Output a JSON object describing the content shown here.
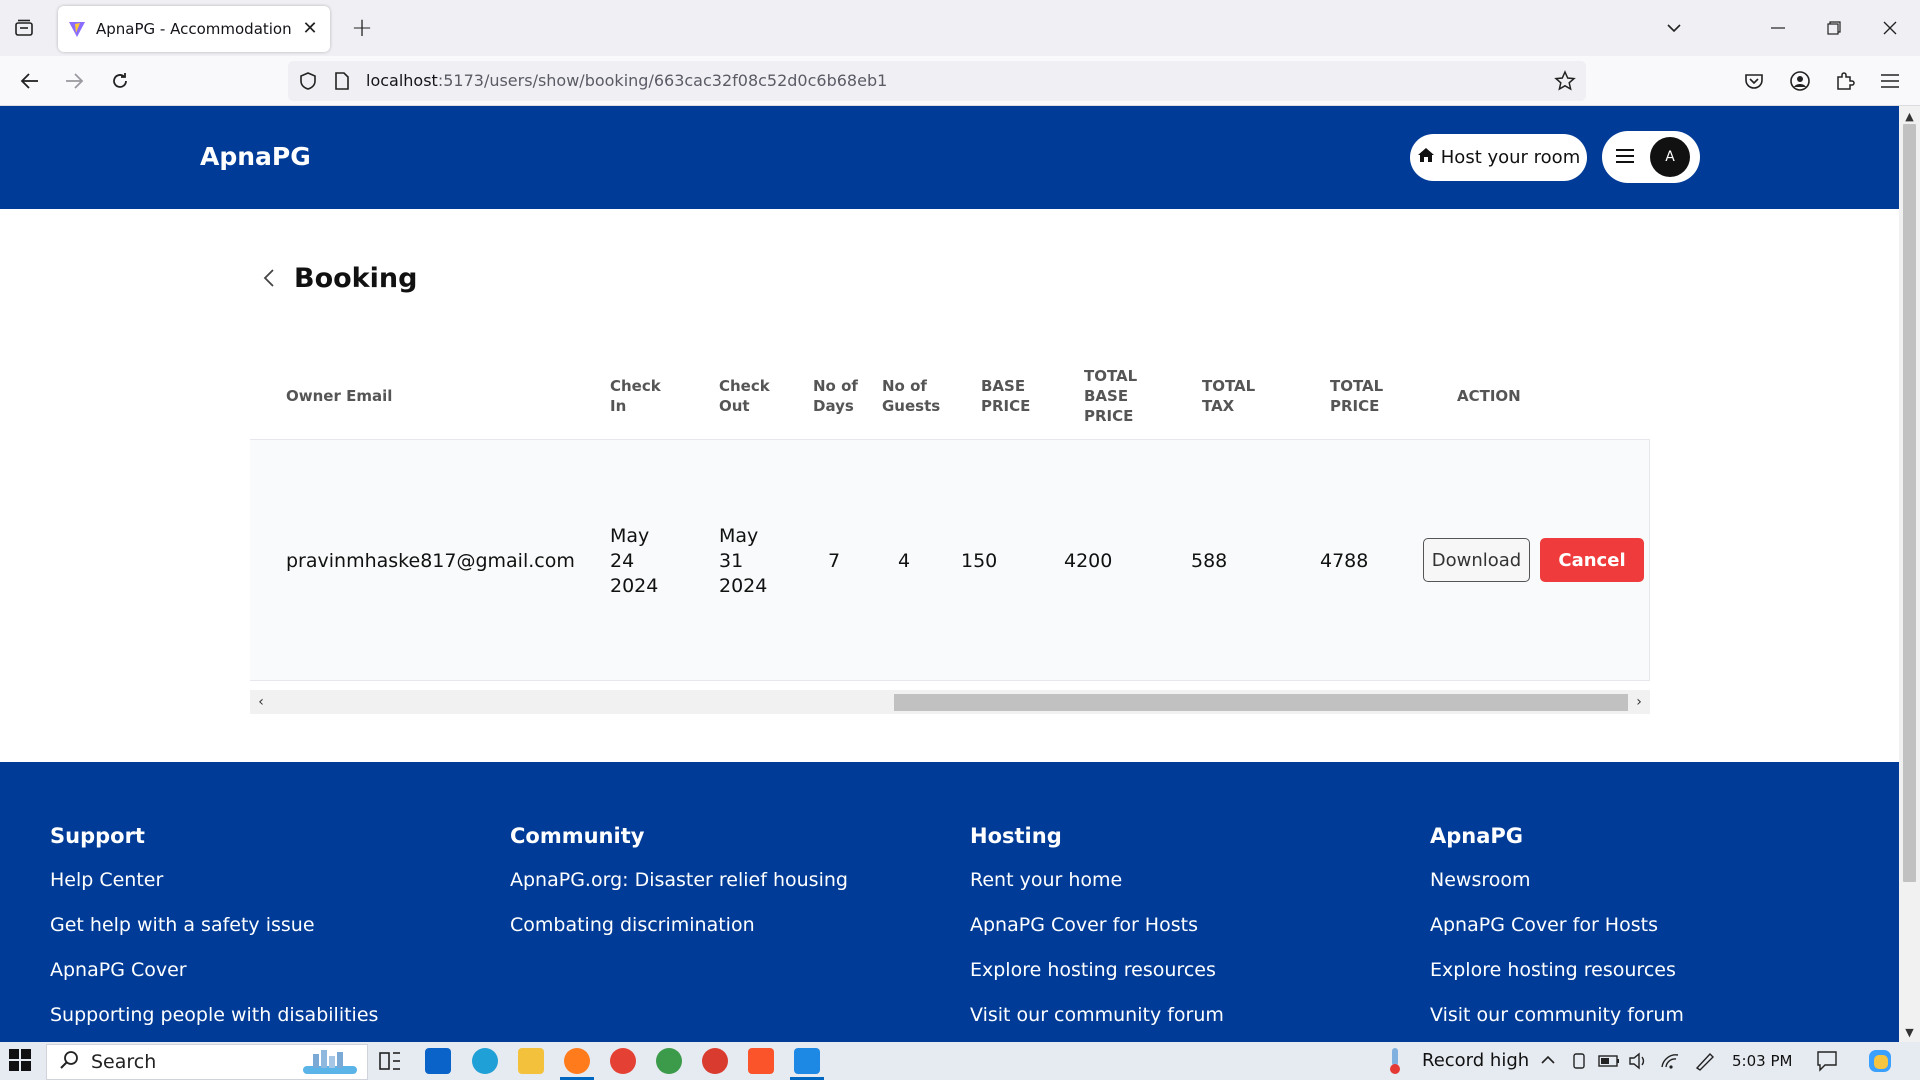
{
  "browser": {
    "tab_title": "ApnaPG - Accommodation Solution",
    "url_host": "localhost",
    "url_path": ":5173/users/show/booking/663cac32f08c52d0c6b68eb1",
    "icons": [
      "tab-list-icon",
      "close-icon",
      "plus-icon",
      "chevron-down-icon",
      "minimize-icon",
      "restore-icon",
      "window-close-icon",
      "back-icon",
      "forward-icon",
      "reload-icon",
      "shield-icon",
      "page-icon",
      "star-icon",
      "pocket-icon",
      "account-icon",
      "extensions-icon",
      "menu-icon"
    ]
  },
  "header": {
    "logo": "ApnaPG",
    "host_button": "Host your room",
    "avatar_initial": "A",
    "brand_color": "#003c97"
  },
  "page": {
    "title": "Booking"
  },
  "table": {
    "headers": {
      "owner_email": "Owner Email",
      "check_in": "Check In",
      "check_out": "Check Out",
      "no_of_days": "No of Days",
      "no_of_guests": "No of Guests",
      "base_price": "BASE PRICE",
      "total_base_price": "TOTAL BASE PRICE",
      "total_tax": "TOTAL TAX",
      "total_price": "TOTAL PRICE",
      "action": "ACTION"
    },
    "rows": [
      {
        "owner_email": "pravinmhaske817@gmail.com",
        "check_in": "May 24 2024",
        "check_out": "May 31 2024",
        "no_of_days": "7",
        "no_of_guests": "4",
        "base_price": "150",
        "total_base_price": "4200",
        "total_tax": "588",
        "total_price": "4788",
        "download_label": "Download",
        "cancel_label": "Cancel"
      }
    ],
    "cancel_color": "#ef3b3b"
  },
  "footer": {
    "columns": [
      {
        "title": "Support",
        "links": [
          "Help Center",
          "Get help with a safety issue",
          "ApnaPG Cover",
          "Supporting people with disabilities"
        ]
      },
      {
        "title": "Community",
        "links": [
          "ApnaPG.org: Disaster relief housing",
          "Combating discrimination"
        ]
      },
      {
        "title": "Hosting",
        "links": [
          "Rent your home",
          "ApnaPG Cover for Hosts",
          "Explore hosting resources",
          "Visit our community forum"
        ]
      },
      {
        "title": "ApnaPG",
        "links": [
          "Newsroom",
          "ApnaPG Cover for Hosts",
          "Explore hosting resources",
          "Visit our community forum"
        ]
      }
    ]
  },
  "taskbar": {
    "search_label": "Search",
    "weather_text": "Record high",
    "time": "5:03 PM"
  }
}
